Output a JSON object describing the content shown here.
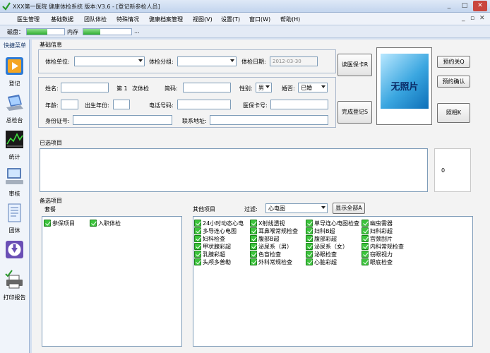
{
  "window": {
    "title": "XXX第一医院 健康体检系统 版本:V3.6 - [登记新参检人员]",
    "minimize": "_",
    "maximize": "□",
    "close": "✕"
  },
  "menu": {
    "items": [
      "医生管理",
      "基础数据",
      "团队体检",
      "特殊情况",
      "健康档案管理",
      "视图(V)",
      "设置(T)",
      "窗口(W)",
      "帮助(H)"
    ],
    "mdi_controls": [
      "_",
      "▫",
      "✕"
    ]
  },
  "status": {
    "disk_label": "磁盘：",
    "disk_usage": 0.55,
    "memory_label": "内存",
    "memory_usage": 0.35,
    "dots": "..."
  },
  "sidebar": {
    "heading": "快捷菜单",
    "items": [
      {
        "label": "登记",
        "icon": "register-icon"
      },
      {
        "label": "总检台",
        "icon": "laptop-icon"
      },
      {
        "label": "统计",
        "icon": "chart-icon"
      },
      {
        "label": "审核",
        "icon": "pc-icon"
      },
      {
        "label": "团体",
        "icon": "document-icon"
      },
      {
        "label": "",
        "icon": "download-icon"
      },
      {
        "label": "打印报告",
        "icon": "printer-icon"
      }
    ]
  },
  "basic": {
    "heading": "基础信息",
    "unit_label": "体检单位:",
    "unit_value": "",
    "group_label": "体检分组:",
    "group_value": "",
    "date_label": "体检日期:",
    "date_value": "2012-03-30",
    "read_card_button": "读医保卡R",
    "register_button": "完成登记S",
    "name_label": "姓名:",
    "name_value": "",
    "visit_prefix": "第 1",
    "visit_suffix": "次体检",
    "abbr_label": "简码:",
    "abbr_value": "",
    "gender_label": "性别:",
    "gender_value": "男",
    "marital_label": "婚否:",
    "marital_value": "已婚",
    "age_label": "年龄:",
    "age_value": "",
    "birth_year_label": "出生年份:",
    "birth_year_value": "",
    "phone_label": "电话号码:",
    "phone_value": "",
    "insurance_label": "医保卡号:",
    "insurance_value": "",
    "id_label": "身份证号:",
    "id_value": "",
    "address_label": "联系地址:",
    "address_value": ""
  },
  "photo": {
    "text": "无照片",
    "appointment_close_button": "预约关Q",
    "appointment_confirm_button": "预约确认",
    "take_photo_button": "照相K"
  },
  "selected": {
    "heading": "已选项目",
    "total": "0"
  },
  "optional": {
    "heading": "备选项目",
    "package_label": "套餐",
    "packages": [
      "参保项目",
      "入职体检"
    ],
    "other_label": "其他项目",
    "filter_label": "过滤:",
    "filter_value": "心电图",
    "show_all_button": "显示全部A",
    "columns": [
      [
        "24小时动态心电",
        "多导连心电图",
        "妇科检查",
        "甲状腺彩超",
        "乳腺彩超",
        "头颅多普勒"
      ],
      [
        "X射线透视",
        "耳鼻喉常规检查",
        "腹部B超",
        "泌尿系（男）",
        "色盲检查",
        "外科常规检查"
      ],
      [
        "单导连心电图检查",
        "妇科B超",
        "腹部彩超",
        "泌尿系（女）",
        "泌眼检查",
        "心脏彩超"
      ],
      [
        "幽虫需器",
        "妇科彩超",
        "宫颈刮片",
        "内科常规检查",
        "窃眼视力",
        "眼底检查"
      ]
    ]
  }
}
